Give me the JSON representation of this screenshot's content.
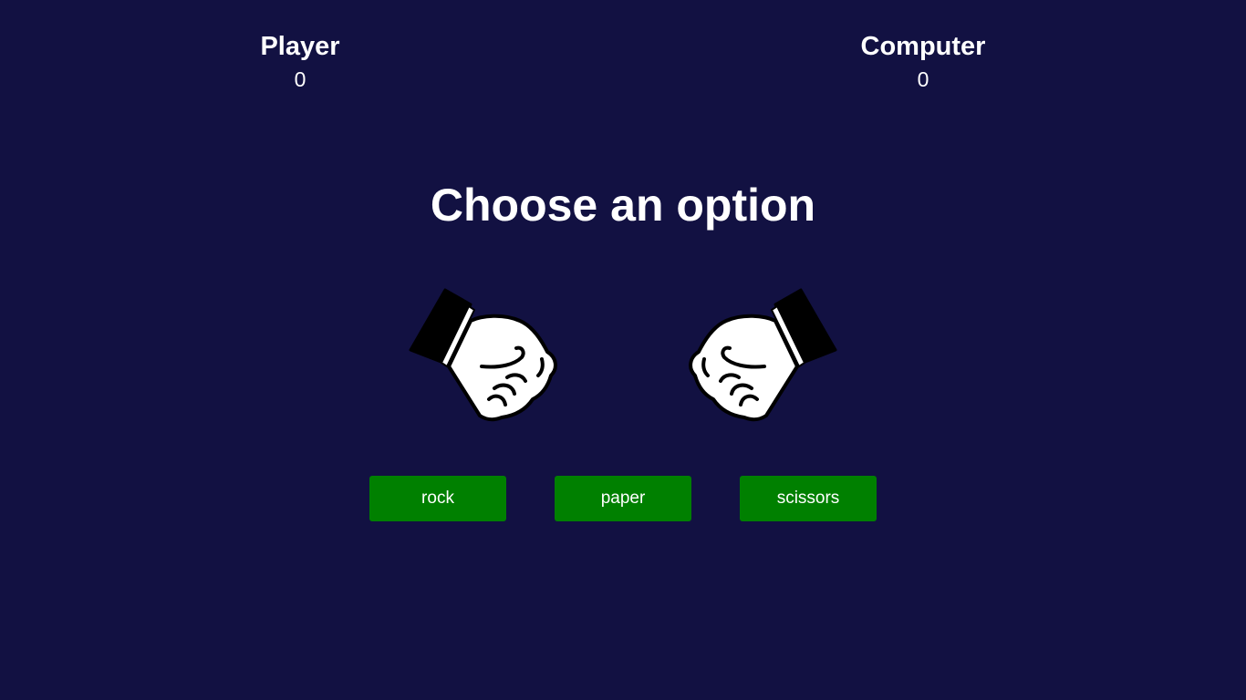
{
  "scoreboard": {
    "player": {
      "label": "Player",
      "score": "0"
    },
    "computer": {
      "label": "Computer",
      "score": "0"
    }
  },
  "heading": "Choose an option",
  "hands": {
    "player": {
      "icon": "fist-icon",
      "choice": "rock"
    },
    "computer": {
      "icon": "fist-icon",
      "choice": "rock"
    }
  },
  "options": [
    {
      "label": "rock"
    },
    {
      "label": "paper"
    },
    {
      "label": "scissors"
    }
  ],
  "colors": {
    "background": "#121142",
    "button": "#008000",
    "text": "#ffffff"
  }
}
